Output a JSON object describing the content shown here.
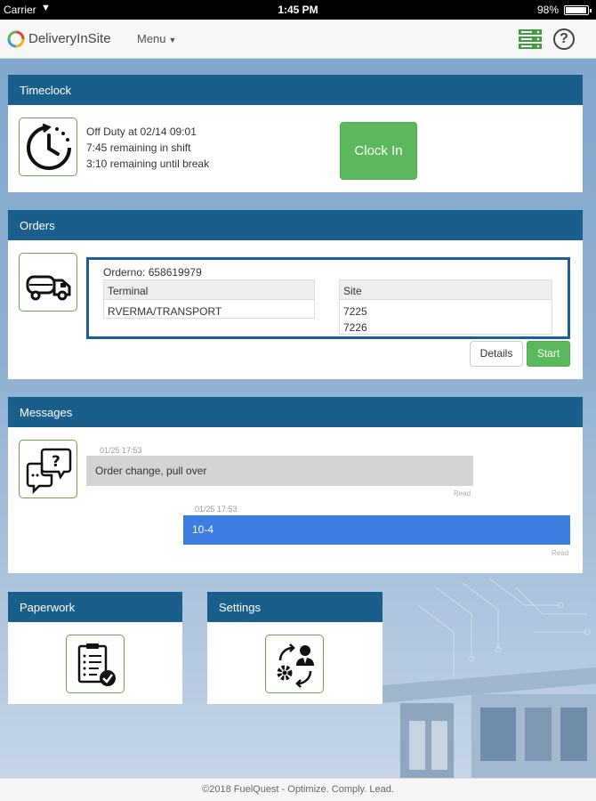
{
  "status_bar": {
    "carrier": "Carrier",
    "time": "1:45 PM",
    "battery": "98%"
  },
  "navbar": {
    "brand": "DeliveryInSite",
    "menu_label": "Menu"
  },
  "timeclock": {
    "title": "Timeclock",
    "lines": [
      "Off Duty at 02/14 09:01",
      "7:45 remaining in shift",
      "3:10 remaining until break"
    ],
    "clock_in_label": "Clock In"
  },
  "orders": {
    "title": "Orders",
    "order_no": "Orderno: 658619979",
    "terminal_header": "Terminal",
    "terminal_value": "RVERMA/TRANSPORT",
    "site_header": "Site",
    "sites": [
      "7225",
      "7226"
    ],
    "details_label": "Details",
    "start_label": "Start"
  },
  "messages": {
    "title": "Messages",
    "items": [
      {
        "time": "01/25 17:53",
        "text": "Order change, pull over",
        "status": "Read"
      },
      {
        "time": "01/25 17:53",
        "text": "10-4",
        "status": "Read"
      }
    ]
  },
  "paperwork": {
    "title": "Paperwork"
  },
  "settings": {
    "title": "Settings"
  },
  "footer": {
    "text": "©2018 FuelQuest - Optimize. Comply. Lead."
  },
  "colors": {
    "header_blue": "#1a5f8c",
    "green": "#5cb85c",
    "outgoing_blue": "#3b7de0",
    "icon_border": "#6ea24d"
  }
}
